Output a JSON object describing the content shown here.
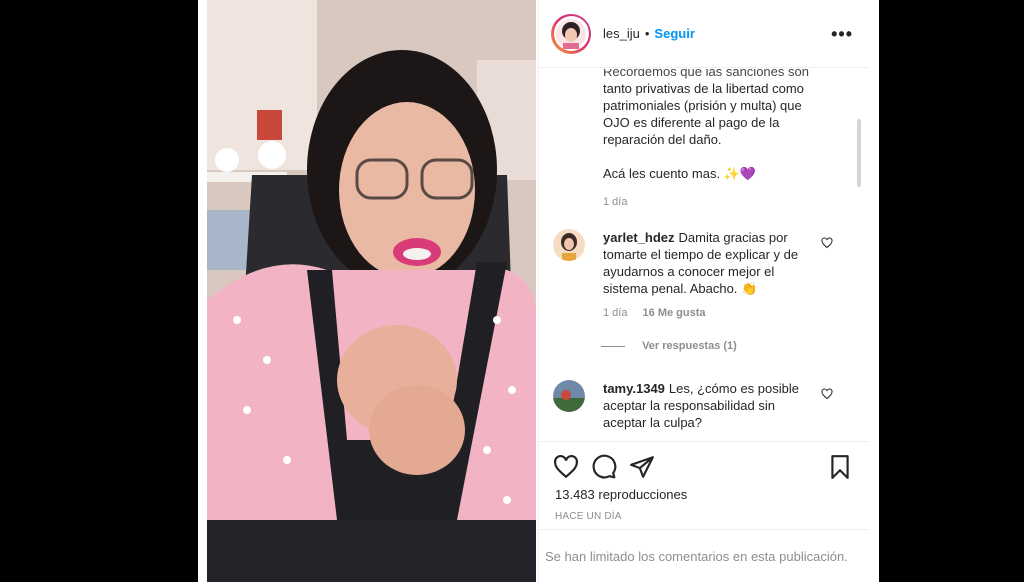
{
  "post": {
    "username": "les_iju",
    "separator": "•",
    "follow_label": "Seguir",
    "more_label": "•••"
  },
  "caption": {
    "truncated_line": "Recordemos que las sanciones son",
    "body": "tanto privativas de la libertad como patrimoniales (prisión y multa) que OJO es diferente al pago de la reparación del daño.",
    "closing": "Acá les cuento mas. ✨💜",
    "time": "1 día"
  },
  "comments": [
    {
      "username": "yarlet_hdez",
      "text": "Damita gracias por tomarte el tiempo de explicar y de ayudarnos a conocer mejor el sistema penal. Abacho. 👏",
      "time": "1 día",
      "likes": "16 Me gusta",
      "replies": "Ver respuestas (1)"
    },
    {
      "username": "tamy.1349",
      "text": "Les, ¿cómo es posible aceptar la responsabilidad sin aceptar la culpa?"
    }
  ],
  "stats": {
    "views": "13.483 reproducciones",
    "posted": "HACE UN DÍA"
  },
  "footer": {
    "limited_comments": "Se han limitado los comentarios en esta publicación."
  },
  "icons": [
    "like-icon",
    "comment-icon",
    "share-icon",
    "save-icon",
    "heart-icon",
    "more-icon"
  ],
  "colors": {
    "accent": "#0095f6",
    "text": "#262626",
    "muted": "#8e8e8e"
  }
}
